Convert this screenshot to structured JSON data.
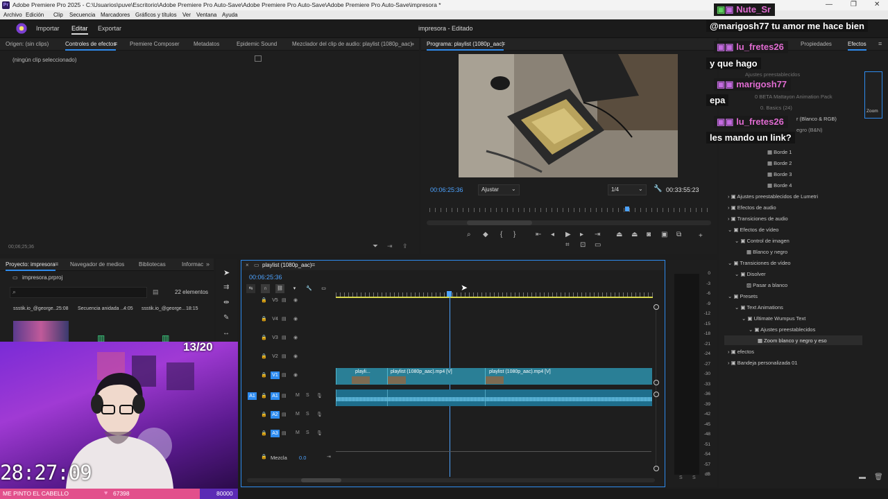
{
  "window": {
    "app_icon": "Pr",
    "title": "Adobe Premiere Pro 2025 - C:\\Usuarios\\puve\\Escritorio\\Adobe Premiere Pro Auto-Save\\Adobe Premiere Pro Auto-Save\\Adobe Premiere Pro Auto-Save\\impresora *",
    "controls": [
      "—",
      "❐",
      "✕"
    ]
  },
  "menu": [
    "Archivo",
    "Edición",
    "Clip",
    "Secuencia",
    "Marcadores",
    "Gráficos y títulos",
    "Ver",
    "Ventana",
    "Ayuda"
  ],
  "workspace": {
    "tabs": [
      "Importar",
      "Editar",
      "Exportar"
    ],
    "active": "Editar",
    "project_title": "impresora - Editado"
  },
  "source_panel": {
    "tabs": [
      "Origen: (sin clips)",
      "Controles de efectos",
      "Premiere Composer",
      "Metadatos",
      "Epidemic Sound",
      "Mezclador del clip de audio: playlist (1080p_aac)"
    ],
    "empty_label": "(ningún clip seleccionado)",
    "timecode": "00;06;25;36"
  },
  "program_panel": {
    "title": "Programa: playlist (1080p_aac)",
    "current_time": "00:06:25:36",
    "fit": "Ajustar",
    "resolution": "1/4",
    "duration": "00:33:55:23"
  },
  "effects_panel": {
    "tabs": [
      "Propiedades",
      "Efectos"
    ],
    "side_label": "Zoom",
    "items": [
      "Ajustes preestablecidos",
      "0 BETA Mattayon Animation Pack",
      "0. Basics (24)",
      "r (Blanco & RGB)",
      "egro (B&N)",
      "Borde 1",
      "Borde 2",
      "Borde 3",
      "Borde 4",
      "Ajustes preestablecidos de Lumetri",
      "Efectos de audio",
      "Transiciones de audio",
      "Efectos de vídeo",
      "Control de imagen",
      "Blanco y negro",
      "Transiciones de vídeo",
      "Disolver",
      "Pasar a blanco",
      "Presets",
      "Text Animations",
      "Ultimate Wumpus Text",
      "Ajustes preestablecidos",
      "Zoom blanco y negro y eso",
      "efectos",
      "Bandeja personalizada 01"
    ]
  },
  "project_panel": {
    "tabs": [
      "Proyecto: impresora",
      "Navegador de medios",
      "Bibliotecas",
      "Informac"
    ],
    "file": "impresora.prproj",
    "count": "22 elementos",
    "items": [
      {
        "name": "ssstik.io_@george...",
        "duration": "25:08"
      },
      {
        "name": "Secuencia anidada ...",
        "duration": "4:05"
      },
      {
        "name": "ssstik.io_@george...",
        "duration": "18:15"
      }
    ]
  },
  "timeline": {
    "tab": "playlist (1080p_aac)",
    "timecode": "00:06:25:36",
    "video_tracks": [
      "V5",
      "V4",
      "V3",
      "V2",
      "V1"
    ],
    "audio_tracks": [
      "A1",
      "A2",
      "A3"
    ],
    "source_patch_v": "V1",
    "source_patch_a": "A1",
    "mix_label": "Mezcla",
    "mix_value": "0.0",
    "clips": [
      "playli...",
      "playlist (1080p_aac).mp4 [V]",
      "playlist (1080p_aac).mp4 [V]"
    ],
    "m_label": "M",
    "s_label": "S",
    "playhead_percent": 36.6
  },
  "audio_meter": {
    "scale": [
      "0",
      "-3",
      "-6",
      "-9",
      "-12",
      "-15",
      "-18",
      "-21",
      "-24",
      "-27",
      "-30",
      "-33",
      "-36",
      "-39",
      "-42",
      "-45",
      "-48",
      "-51",
      "-54",
      "-57",
      "dB"
    ],
    "footer": [
      "S",
      "S"
    ]
  },
  "overlay": {
    "goal_counter": "13/20",
    "clock": "28:27:09",
    "bar_label": "ME PINTO EL CABELLO",
    "bar_current": "67398",
    "bar_goal": "80000",
    "bar_progress": 0.84
  },
  "chat": [
    {
      "user": "Nute_Sr",
      "message": "@marigosh77 tu amor me hace bien"
    },
    {
      "user": "lu_fretes26",
      "message": "y que hago"
    },
    {
      "user": "marigosh77",
      "message": "epa"
    },
    {
      "user": "lu_fretes26",
      "message": "les mando un link?"
    }
  ],
  "colors": {
    "accent_blue": "#2e8cf0",
    "clip_video": "#2a7f96",
    "clip_audio": "#1e6e8c",
    "chat_name": "#e06bd1",
    "bar_pink": "#e2508c",
    "bar_purple": "#5b2ab5"
  }
}
